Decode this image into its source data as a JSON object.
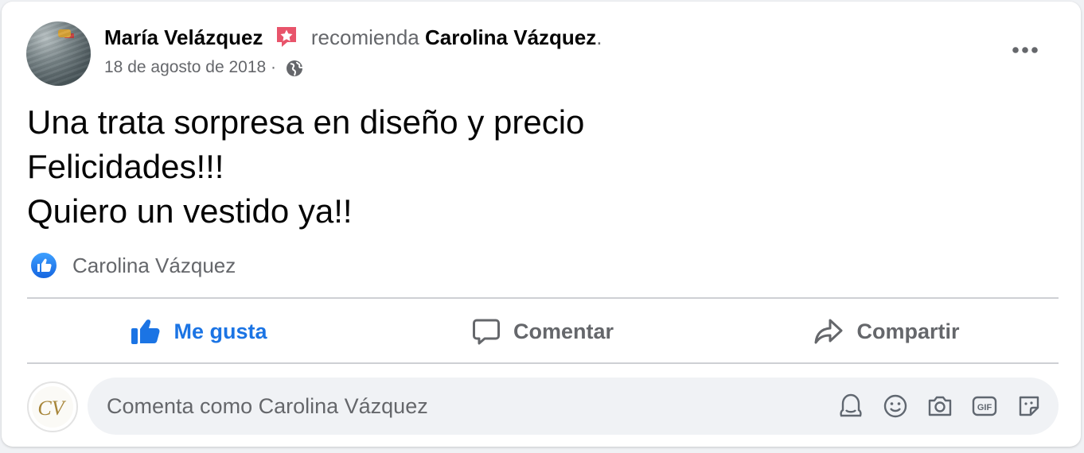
{
  "post": {
    "author": "María Velázquez",
    "action_text": "recomienda",
    "page_name": "Carolina Vázquez",
    "period": ".",
    "date": "18 de agosto de 2018",
    "date_separator": "·",
    "privacy_icon": "globe-icon",
    "badge_icon": "star-icon",
    "badge_color": "#e8546b",
    "text_lines": [
      "Una trata sorpresa en diseño y precio",
      "Felicidades!!!",
      "Quiero un vestido ya!!"
    ]
  },
  "reactions": {
    "icon": "like-icon",
    "name": "Carolina Vázquez"
  },
  "actions": {
    "like_label": "Me gusta",
    "comment_label": "Comentar",
    "share_label": "Compartir"
  },
  "composer": {
    "avatar_monogram": "CV",
    "placeholder": "Comenta como Carolina Vázquez",
    "icons": [
      "avatar-sticker-icon",
      "emoji-icon",
      "camera-icon",
      "gif-icon",
      "sticker-icon"
    ]
  },
  "colors": {
    "accent": "#1b74e4",
    "secondary_text": "#65676b",
    "primary_text": "#050505",
    "monogram": "#a78539"
  }
}
